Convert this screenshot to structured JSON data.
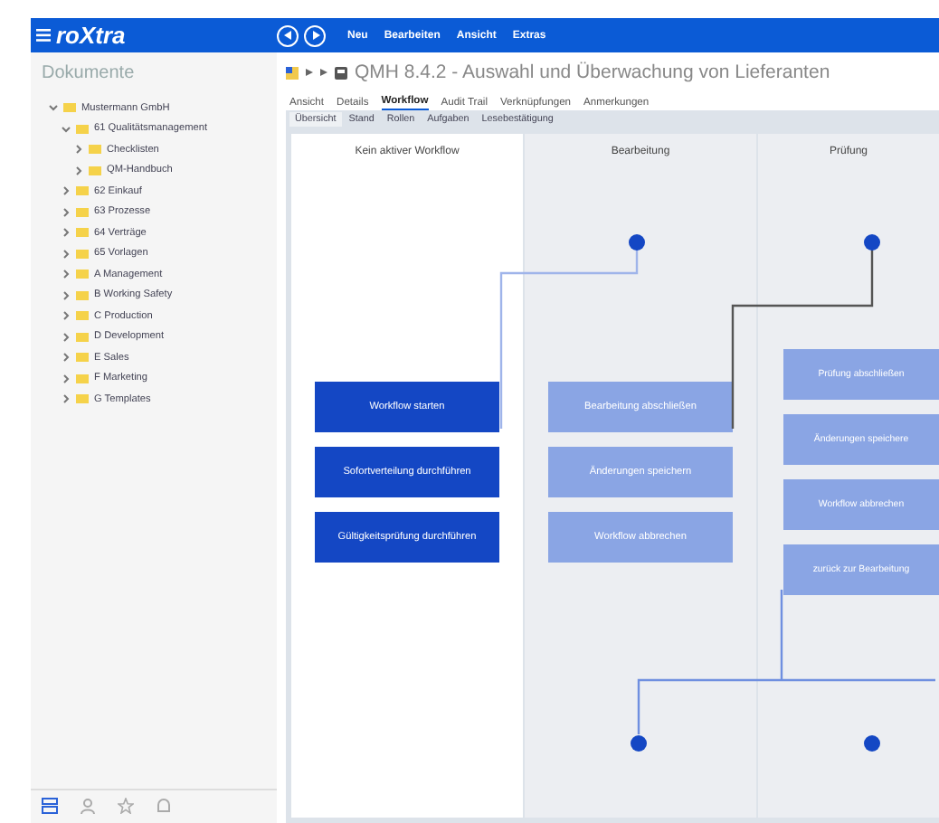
{
  "app_bar": {
    "logo": "roXtra",
    "menu": [
      "Neu",
      "Bearbeiten",
      "Ansicht",
      "Extras"
    ]
  },
  "sidebar": {
    "title": "Dokumente",
    "tree": [
      {
        "label": "Mustermann GmbH",
        "expanded": true,
        "children": [
          {
            "label": "61 Qualitätsmanagement",
            "expanded": true,
            "children": [
              {
                "label": "Checklisten",
                "expanded": false
              },
              {
                "label": "QM-Handbuch",
                "expanded": false
              }
            ]
          },
          {
            "label": "62 Einkauf",
            "expanded": false
          },
          {
            "label": "63 Prozesse",
            "expanded": false
          },
          {
            "label": "64 Verträge",
            "expanded": false
          },
          {
            "label": "65 Vorlagen",
            "expanded": false
          },
          {
            "label": "A Management",
            "expanded": false
          },
          {
            "label": "B Working Safety",
            "expanded": false
          },
          {
            "label": "C Production",
            "expanded": false
          },
          {
            "label": "D Development",
            "expanded": false
          },
          {
            "label": "E Sales",
            "expanded": false
          },
          {
            "label": "F Marketing",
            "expanded": false
          },
          {
            "label": "G Templates",
            "expanded": false
          }
        ]
      }
    ],
    "footer_icons": [
      {
        "kind": "tree",
        "selected": true
      },
      {
        "kind": "person",
        "selected": false
      },
      {
        "kind": "star",
        "selected": false
      },
      {
        "kind": "bell",
        "selected": false
      }
    ]
  },
  "document": {
    "title": "QMH 8.4.2 - Auswahl und Überwachung von Lieferanten",
    "tabs": [
      {
        "label": "Ansicht",
        "selected": false
      },
      {
        "label": "Details",
        "selected": false
      },
      {
        "label": "Workflow",
        "selected": true
      },
      {
        "label": "Audit Trail",
        "selected": false
      },
      {
        "label": "Verknüpfungen",
        "selected": false
      },
      {
        "label": "Anmerkungen",
        "selected": false
      }
    ],
    "subtabs": [
      {
        "label": "Übersicht",
        "selected": true
      },
      {
        "label": "Stand",
        "selected": false
      },
      {
        "label": "Rollen",
        "selected": false
      },
      {
        "label": "Aufgaben",
        "selected": false
      },
      {
        "label": "Lesebestätigung",
        "selected": false
      }
    ]
  },
  "workflow": {
    "columns": [
      {
        "header": "Kein aktiver Workflow",
        "active": true,
        "actions": [
          {
            "label": "Workflow starten",
            "disabled": false
          },
          {
            "label": "Sofortverteilung durchführen",
            "disabled": false
          },
          {
            "label": "Gültigkeitsprüfung durchführen",
            "disabled": false
          }
        ]
      },
      {
        "header": "Bearbeitung",
        "active": false,
        "actions": [
          {
            "label": "Bearbeitung abschließen",
            "disabled": true
          },
          {
            "label": "Änderungen speichern",
            "disabled": true
          },
          {
            "label": "Workflow abbrechen",
            "disabled": true
          }
        ]
      },
      {
        "header": "Prüfung",
        "active": false,
        "actions": [
          {
            "label": "Prüfung abschließen",
            "disabled": true
          },
          {
            "label": "Änderungen speichere",
            "disabled": true
          },
          {
            "label": "Workflow abbrechen",
            "disabled": true
          },
          {
            "label": "zurück zur Bearbeitung",
            "disabled": true
          }
        ]
      }
    ]
  }
}
